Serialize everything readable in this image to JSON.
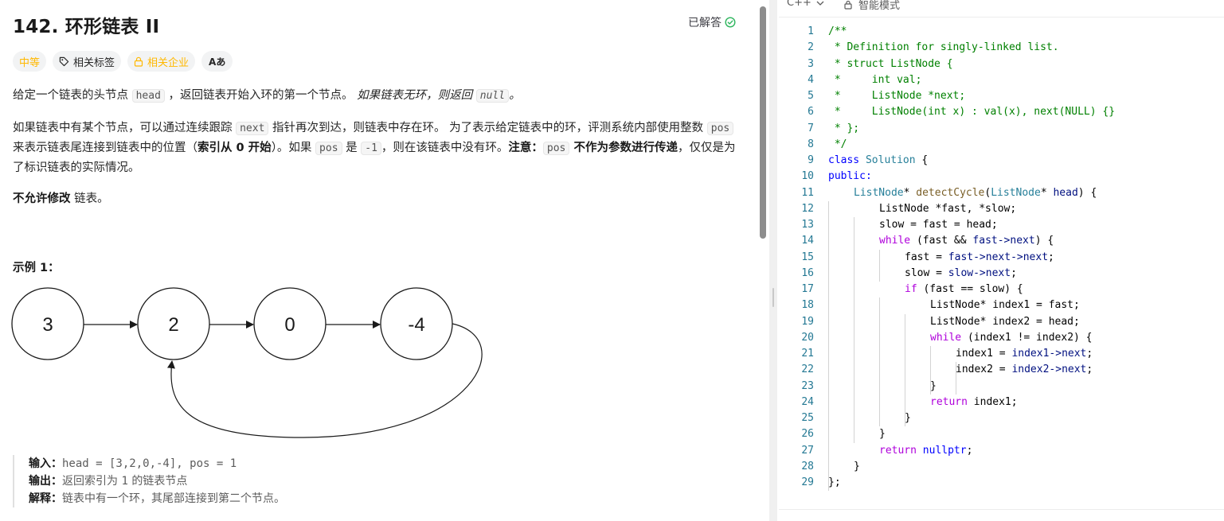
{
  "problem": {
    "title": "142. 环形链表 II",
    "status": "已解答",
    "tags": {
      "difficulty": "中等",
      "related_tags": "相关标签",
      "related_companies": "相关企业",
      "translate": "Aあ"
    },
    "description": {
      "p1_a": "给定一个链表的头节点 ",
      "p1_code1": "head",
      "p1_b": " ，返回链表开始入环的第一个节点。 ",
      "p1_c": "如果链表无环，则返回 ",
      "p1_code2": "null",
      "p1_d": "。",
      "p2_a": "如果链表中有某个节点，可以通过连续跟踪 ",
      "p2_code1": "next",
      "p2_b": " 指针再次到达，则链表中存在环。 为了表示给定链表中的环，评测系统内部使用整数 ",
      "p2_code2": "pos",
      "p2_c": " 来表示链表尾连接到链表中的位置（",
      "p2_bold1": "索引从 0 开始",
      "p2_d": "）。如果 ",
      "p2_code3": "pos",
      "p2_e": " 是 ",
      "p2_code4": "-1",
      "p2_f": "，则在该链表中没有环。",
      "p2_bold2": "注意：",
      "p2_code5": "pos",
      "p2_bold3": " 不作为参数进行传递",
      "p2_g": "，仅仅是为了标识链表的实际情况。",
      "p3_bold": "不允许修改",
      "p3_rest": " 链表。"
    },
    "example": {
      "title": "示例 1：",
      "nodes": [
        "3",
        "2",
        "0",
        "-4"
      ],
      "input_label": "输入：",
      "input_value": "head = [3,2,0,-4], pos = 1",
      "output_label": "输出：",
      "output_a": "返回索引为 ",
      "output_code": "1",
      "output_b": " 的链表节点",
      "explain_label": "解释：",
      "explain_value": "链表中有一个环，其尾部连接到第二个节点。"
    }
  },
  "editor": {
    "language": "C++",
    "mode": "智能模式",
    "line_numbers": [
      "1",
      "2",
      "3",
      "4",
      "5",
      "6",
      "7",
      "8",
      "9",
      "10",
      "11",
      "12",
      "13",
      "14",
      "15",
      "16",
      "17",
      "18",
      "19",
      "20",
      "21",
      "22",
      "23",
      "24",
      "25",
      "26",
      "27",
      "28",
      "29"
    ],
    "code": {
      "l1": "/**",
      "l2": " * Definition for singly-linked list.",
      "l3": " * struct ListNode {",
      "l4": " *     int val;",
      "l5": " *     ListNode *next;",
      "l6": " *     ListNode(int x) : val(x), next(NULL) {}",
      "l7": " * };",
      "l8": " */",
      "l9_kw": "class",
      "l9_type": "Solution",
      "l9_rest": " {",
      "l10": "public:",
      "l11_type": "ListNode",
      "l11_a": "* ",
      "l11_fn": "detectCycle",
      "l11_b": "(",
      "l11_type2": "ListNode",
      "l11_c": "* ",
      "l11_var": "head",
      "l11_d": ") {",
      "l12": "ListNode *fast, *slow;",
      "l13": "slow = fast = head;",
      "l14_ctrl": "while",
      "l14_rest": " (fast && ",
      "l14_var": "fast->next",
      "l14_end": ") {",
      "l15_a": "fast = ",
      "l15_var": "fast->next->next",
      "l15_b": ";",
      "l16_a": "slow = ",
      "l16_var": "slow->next",
      "l16_b": ";",
      "l17_ctrl": "if",
      "l17_rest": " (fast == slow) {",
      "l18": "ListNode* index1 = fast;",
      "l19": "ListNode* index2 = head;",
      "l20_ctrl": "while",
      "l20_rest": " (index1 != index2) {",
      "l21_a": "index1 = ",
      "l21_var": "index1->next",
      "l21_b": ";",
      "l22_a": "index2 = ",
      "l22_var": "index2->next",
      "l22_b": ";",
      "l23": "}",
      "l24_ctrl": "return",
      "l24_rest": " index1;",
      "l25": "}",
      "l26": "}",
      "l27_ctrl": "return",
      "l27_kw": "nullptr",
      "l27_b": ";",
      "l28": "}",
      "l29": "};"
    }
  },
  "colors": {
    "accent_orange": "#ffb800",
    "solved_green": "#2db55d",
    "line_number": "#237893",
    "comment": "#008000",
    "keyword": "#0000ff",
    "control": "#af00db",
    "type": "#267f99",
    "function": "#795e26"
  }
}
